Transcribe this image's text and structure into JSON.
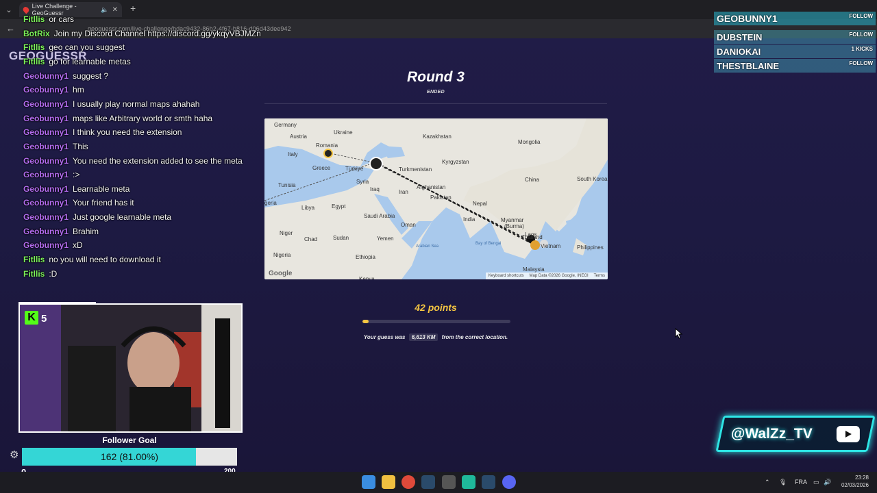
{
  "browser": {
    "tab_title": "Live Challenge - GeoGuessr",
    "url": "geoguessr.com/live-challenge/bdac9432-86b2-4f67-b816-d06d43dee942"
  },
  "overlay_logo": "GEOGUESSR",
  "chat": [
    {
      "user": "Fitllis",
      "text": "or cars",
      "color": "#7cf25a"
    },
    {
      "user": "BotRix",
      "text": "Join my Discord Channel https://discord.gg/ykqyVBJMZn",
      "color": "#7cf25a"
    },
    {
      "user": "Fitllis",
      "text": "geo can you suggest",
      "color": "#7cf25a"
    },
    {
      "user": "Fitllis",
      "text": "go for learnable metas",
      "color": "#7cf25a"
    },
    {
      "user": "Geobunny1",
      "text": "suggest ?",
      "color": "#b46cf0"
    },
    {
      "user": "Geobunny1",
      "text": "hm",
      "color": "#b46cf0"
    },
    {
      "user": "Geobunny1",
      "text": "I usually play normal maps ahahah",
      "color": "#b46cf0"
    },
    {
      "user": "Geobunny1",
      "text": "maps like Arbitrary world or smth haha",
      "color": "#b46cf0"
    },
    {
      "user": "Geobunny1",
      "text": "I think you need the extension",
      "color": "#b46cf0"
    },
    {
      "user": "Geobunny1",
      "text": "This",
      "color": "#b46cf0"
    },
    {
      "user": "Geobunny1",
      "text": "You need the extension added to see the meta",
      "color": "#b46cf0"
    },
    {
      "user": "Geobunny1",
      "text": ":>",
      "color": "#b46cf0"
    },
    {
      "user": "Geobunny1",
      "text": "Learnable meta",
      "color": "#b46cf0"
    },
    {
      "user": "Geobunny1",
      "text": "Your friend has it",
      "color": "#b46cf0"
    },
    {
      "user": "Geobunny1",
      "text": "Just google learnable meta",
      "color": "#b46cf0"
    },
    {
      "user": "Geobunny1",
      "text": "Brahim",
      "color": "#b46cf0"
    },
    {
      "user": "Geobunny1",
      "text": "xD",
      "color": "#b46cf0"
    },
    {
      "user": "Fitllis",
      "text": "no you will need to download it",
      "color": "#7cf25a"
    },
    {
      "user": "Fitllis",
      "text": ":D",
      "color": "#7cf25a"
    }
  ],
  "round": {
    "title": "Round 3",
    "status": "ENDED",
    "points": "42 points",
    "score_fraction": 0.04,
    "distance_prefix": "Your guess was",
    "distance_value": "6,613 KM",
    "distance_suffix": "from the correct location."
  },
  "map": {
    "labels": [
      "Germany",
      "Ukraine",
      "Kazakhstan",
      "Mongolia",
      "Austria",
      "Romania",
      "Italy",
      "Greece",
      "Türkiye",
      "Turkmenistan",
      "Kyrgyzstan",
      "Tunisia",
      "Syria",
      "Iraq",
      "Afghanistan",
      "China",
      "South Korea",
      "geria",
      "Iran",
      "Pakistan",
      "Nepal",
      "Libya",
      "Egypt",
      "Saudi Arabia",
      "India",
      "Myanmar",
      "(Burma)",
      "Oman",
      "Niger",
      "Chad",
      "Sudan",
      "Yemen",
      "Thailand",
      "Philippines",
      "Arabian Sea",
      "Bay of Bengal",
      "Nigeria",
      "Ethiopia",
      "Malaysia",
      "Kenya",
      "Vietnam",
      "Laos"
    ],
    "google": "Google",
    "footer": [
      "Keyboard shortcuts",
      "Map Data ©2026 Google, INEGI",
      "Terms"
    ]
  },
  "viewers": [
    {
      "name": "GEOBUNNY1",
      "action": "FOLLOW"
    },
    {
      "name": "DUBSTEIN",
      "action": "FOLLOW"
    },
    {
      "name": "DANIOKAI",
      "action": "1 KICKS"
    },
    {
      "name": "THESTBLAINE",
      "action": "FOLLOW"
    }
  ],
  "webcam": {
    "kick_count": "5",
    "kick_logo": "K"
  },
  "follower_goal": {
    "title": "Follower Goal",
    "progress_text": "162 (81.00%)",
    "fraction": 0.81,
    "min": "0",
    "max": "200"
  },
  "social": {
    "handle": "@WalZz_TV",
    "icon": "youtube-icon",
    "accent": "#2ee6e6"
  },
  "taskbar": {
    "lang": "FRA",
    "time": "23:28",
    "date": "02/03/2026",
    "icons": [
      "windows-start-icon",
      "file-explorer-icon",
      "chrome-icon",
      "steam-icon",
      "settings-icon",
      "app-icon",
      "steam-icon-2",
      "discord-icon"
    ]
  }
}
